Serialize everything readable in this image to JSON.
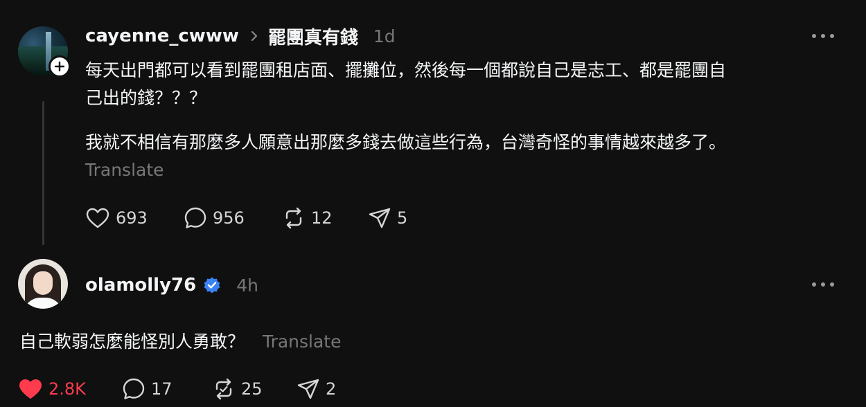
{
  "post": {
    "username": "cayenne_cwww",
    "topic": "罷團真有錢",
    "time": "1d",
    "line1": "每天出門都可以看到罷團租店面、擺攤位，然後每一個都說自己是志工、都是罷團自",
    "line2": "己出的錢？？？",
    "line3": "我就不相信有那麼多人願意出那麼多錢去做這些行為，台灣奇怪的事情越來越多了。",
    "translate": "Translate",
    "likes": "693",
    "replies": "956",
    "reposts": "12",
    "shares": "5"
  },
  "reply": {
    "username": "olamolly76",
    "time": "4h",
    "text": "自己軟弱怎麼能怪別人勇敢？",
    "translate": "Translate",
    "likes": "2.8K",
    "replies": "17",
    "reposts": "25",
    "shares": "2"
  },
  "colors": {
    "background": "#101010",
    "text": "#f3f5f7",
    "muted": "#777777",
    "like_active": "#ff3b4d",
    "verified": "#1d9bf0"
  },
  "icons": [
    "plus-icon",
    "chevron-right-icon",
    "more-icon",
    "heart-icon",
    "comment-icon",
    "repost-icon",
    "share-icon",
    "verified-badge-icon"
  ]
}
